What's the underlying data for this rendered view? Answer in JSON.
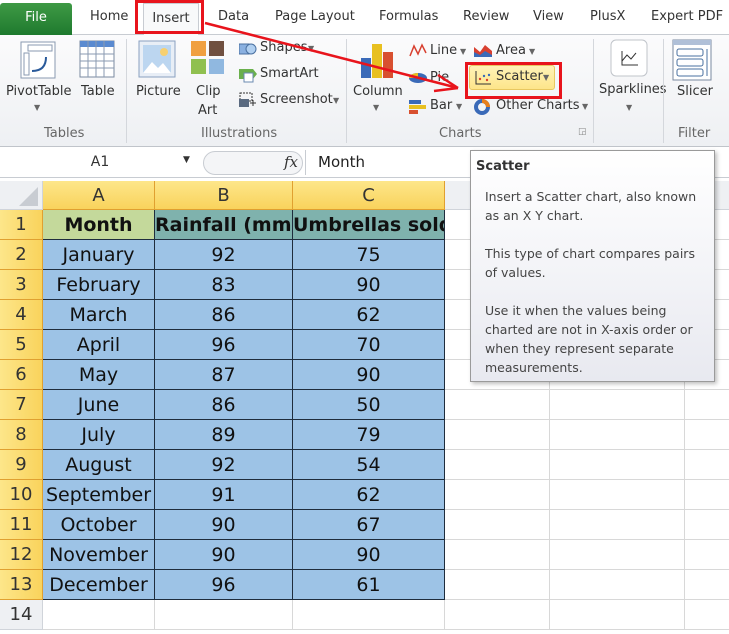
{
  "ribbon_tabs": {
    "file": "File",
    "home": "Home",
    "insert": "Insert",
    "data": "Data",
    "page_layout": "Page Layout",
    "formulas": "Formulas",
    "review": "Review",
    "view": "View",
    "plusx": "PlusX",
    "expert_pdf": "Expert PDF"
  },
  "ribbon": {
    "tables": {
      "label": "Tables",
      "pivot_table": "PivotTable",
      "table": "Table"
    },
    "illustrations": {
      "label": "Illustrations",
      "picture": "Picture",
      "clip": "Clip",
      "art": "Art",
      "shapes": "Shapes",
      "smartart": "SmartArt",
      "screenshot": "Screenshot"
    },
    "charts": {
      "label": "Charts",
      "column": "Column",
      "line": "Line",
      "area": "Area",
      "pie": "Pie",
      "scatter": "Scatter",
      "bar": "Bar",
      "other_charts": "Other Charts"
    },
    "sparklines": {
      "label": "Sparklines"
    },
    "filter": {
      "label": "Filter",
      "slicer": "Slicer"
    }
  },
  "formula_bar": {
    "name_box": "A1",
    "fx": "fx",
    "value": "Month"
  },
  "columns": [
    "A",
    "B",
    "C"
  ],
  "rows": [
    "1",
    "2",
    "3",
    "4",
    "5",
    "6",
    "7",
    "8",
    "9",
    "10",
    "11",
    "12",
    "13",
    "14"
  ],
  "table": {
    "headers": [
      "Month",
      "Rainfall (mm)",
      "Umbrellas sold"
    ],
    "data": [
      [
        "January",
        "92",
        "75"
      ],
      [
        "February",
        "83",
        "90"
      ],
      [
        "March",
        "86",
        "62"
      ],
      [
        "April",
        "96",
        "70"
      ],
      [
        "May",
        "87",
        "90"
      ],
      [
        "June",
        "86",
        "50"
      ],
      [
        "July",
        "89",
        "79"
      ],
      [
        "August",
        "92",
        "54"
      ],
      [
        "September",
        "91",
        "62"
      ],
      [
        "October",
        "90",
        "67"
      ],
      [
        "November",
        "90",
        "90"
      ],
      [
        "December",
        "96",
        "61"
      ]
    ]
  },
  "tooltip": {
    "title": "Scatter",
    "p1": "Insert a Scatter chart, also known as an X Y chart.",
    "p2": "This type of chart compares pairs of values.",
    "p3": "Use it when the values being charted are not in X-axis order or when they represent separate measurements."
  },
  "colors": {
    "annotation_red": "#e8141c",
    "header_yellow": "#f9d35c",
    "data_blue": "#9dc3e6",
    "month_header_green": "#c4d99b",
    "teal_header": "#7fb2ad",
    "file_green": "#2a8a36"
  }
}
